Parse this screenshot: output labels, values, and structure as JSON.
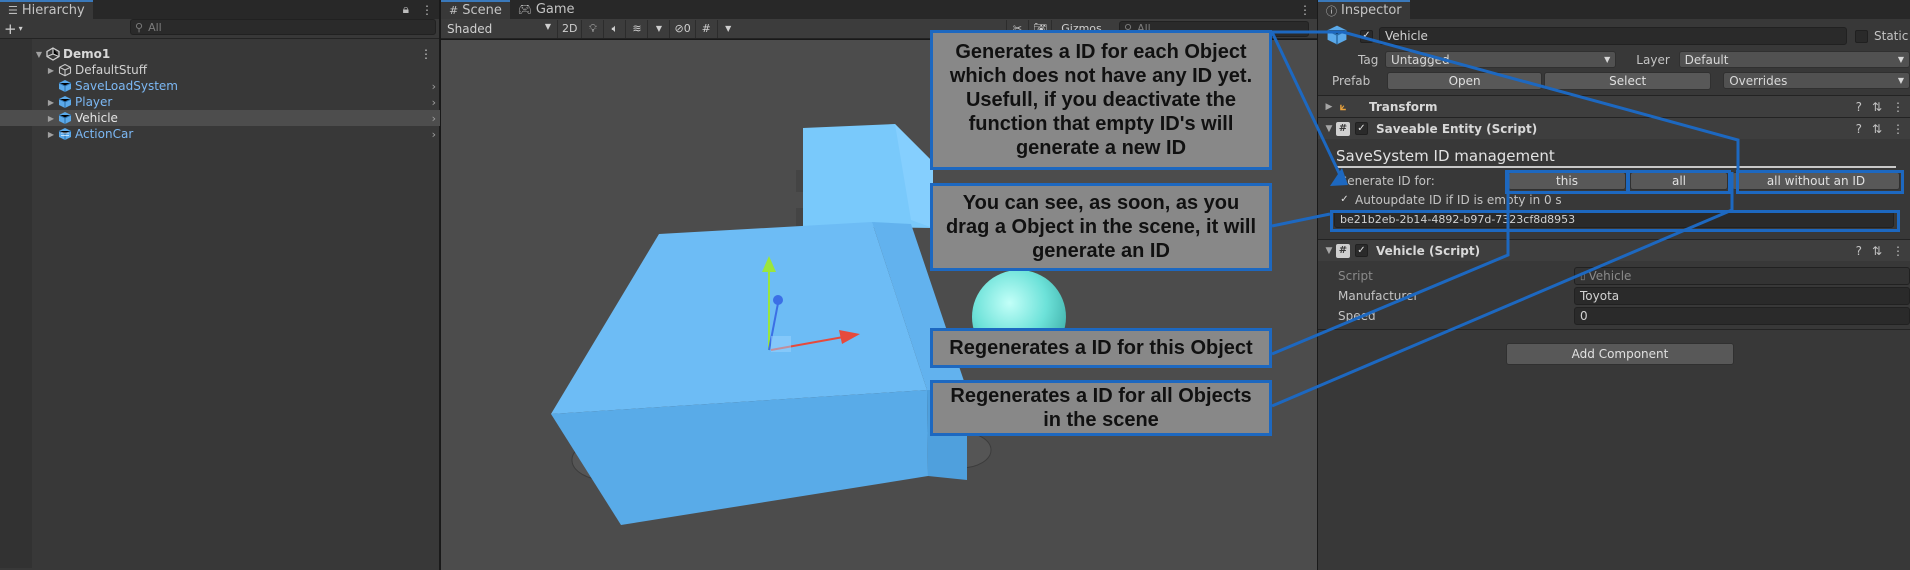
{
  "hierarchy": {
    "tab_label": "Hierarchy",
    "search_placeholder": "All",
    "items": [
      {
        "label": "Demo1",
        "kind": "scene",
        "indent": 0
      },
      {
        "label": "DefaultStuff",
        "kind": "object",
        "indent": 1
      },
      {
        "label": "SaveLoadSystem",
        "kind": "prefab",
        "indent": 1
      },
      {
        "label": "Player",
        "kind": "prefab",
        "indent": 1
      },
      {
        "label": "Vehicle",
        "kind": "prefab",
        "indent": 1,
        "selected": true
      },
      {
        "label": "ActionCar",
        "kind": "prefab",
        "indent": 1
      }
    ]
  },
  "scene": {
    "tabs": [
      "Scene",
      "Game"
    ],
    "shading_mode": "Shaded",
    "mode_2d": "2D",
    "hidden_count": "0",
    "gizmos_label": "Gizmos",
    "search_placeholder": "All",
    "persp_label": "sp"
  },
  "inspector": {
    "tab_label": "Inspector",
    "object_name": "Vehicle",
    "static_label": "Static",
    "tag_label": "Tag",
    "tag_value": "Untagged",
    "layer_label": "Layer",
    "layer_value": "Default",
    "prefab_label": "Prefab",
    "prefab_open": "Open",
    "prefab_select": "Select",
    "prefab_overrides": "Overrides",
    "components": {
      "transform": "Transform",
      "saveable": "Saveable Entity (Script)",
      "vehicle": "Vehicle (Script)"
    },
    "saveable_body": {
      "title": "SaveSystem ID management",
      "generate_label": "Generate ID for:",
      "btn_this": "this",
      "btn_all": "all",
      "btn_all_without": "all without an ID",
      "autoupdate_label": "Autoupdate ID if ID is empty in 0 s",
      "id_value": "be21b2eb-2b14-4892-b97d-7323cf8d8953"
    },
    "vehicle_body": {
      "script_label": "Script",
      "script_value": "Vehicle",
      "manufacturer_label": "Manufacturer",
      "manufacturer_value": "Toyota",
      "speed_label": "Speed",
      "speed_value": "0"
    },
    "add_component": "Add Component"
  },
  "callouts": {
    "generate_all_without": "Generates a ID for each Object which does not have any ID yet. Usefull, if you deactivate the function that empty ID's will generate a new ID",
    "drag_generate": "You can see, as soon, as you drag a Object in the scene, it will generate an ID",
    "regen_this": "Regenerates a ID for this Object",
    "regen_all": "Regenerates a ID for all Objects in the scene"
  },
  "colors": {
    "accent_blue": "#1d68c0",
    "prefab_text": "#7cb8f4",
    "callout_bg": "#888888",
    "object_cube": "#5bb6f2"
  },
  "icons": {
    "hierarchy_tab": "list-icon",
    "inspector_tab": "info-icon",
    "scene_tab": "grid-icon",
    "game_tab": "gamepad-icon",
    "lock": "lock-icon",
    "kebab": "kebab-menu-icon",
    "cube": "prefab-cube-icon",
    "help": "help-icon",
    "settings": "sliders-icon"
  }
}
